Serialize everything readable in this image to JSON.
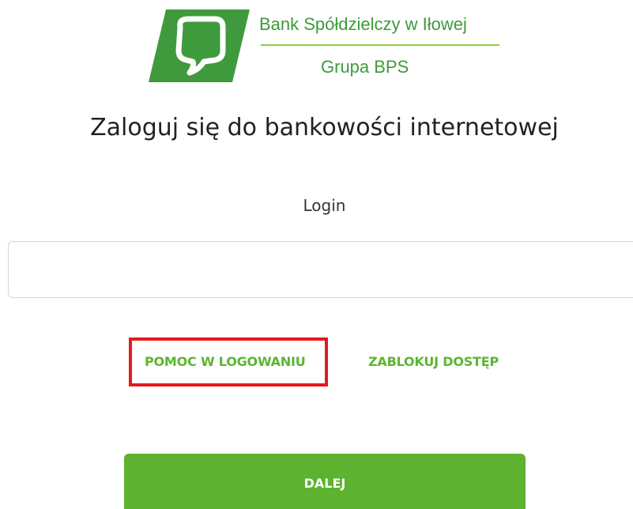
{
  "logo": {
    "bank_name": "Bank Spółdzielczy w Iłowej",
    "group_name": "Grupa BPS",
    "colors": {
      "dark_green": "#3f9a3d",
      "light_green": "#8ccc3e"
    }
  },
  "heading": "Zaloguj się do bankowości internetowej",
  "login": {
    "label": "Login",
    "value": "",
    "placeholder": ""
  },
  "links": {
    "help": "POMOC W LOGOWANIU",
    "block_access": "ZABLOKUJ DOSTĘP"
  },
  "next_button": {
    "label": "DALEJ"
  },
  "colors": {
    "accent": "#5db22f",
    "highlight": "#e8181b",
    "text": "#222222"
  }
}
